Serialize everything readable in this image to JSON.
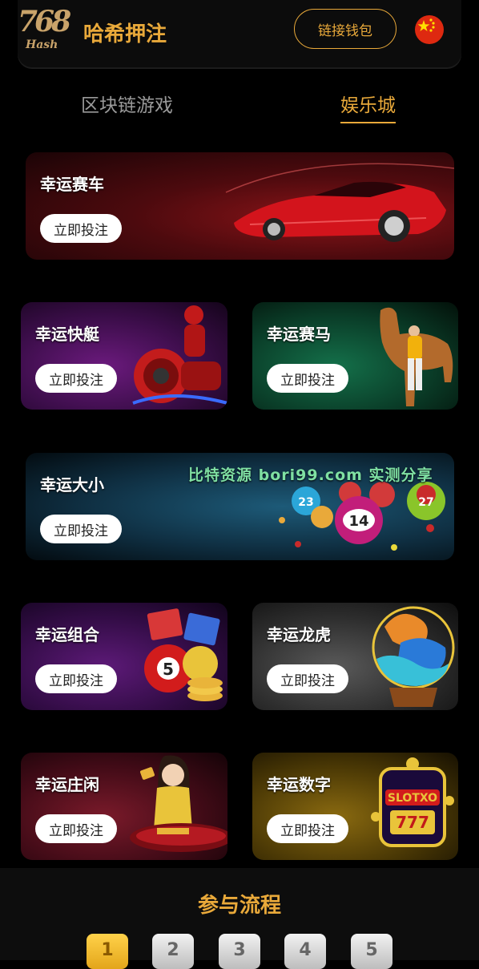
{
  "header": {
    "logo_number": "768",
    "logo_sub": "Hash",
    "brand": "哈希押注",
    "wallet_button": "链接钱包",
    "flag_icon": "china-flag-icon"
  },
  "tabs": [
    {
      "label": "区块链游戏",
      "active": false
    },
    {
      "label": "娱乐城",
      "active": true
    }
  ],
  "bet_label": "立即投注",
  "games": [
    {
      "title": "幸运赛车",
      "art": "red-sports-car"
    },
    {
      "title": "幸运快艇",
      "art": "speedboat-rider"
    },
    {
      "title": "幸运赛马",
      "art": "horse-jockey"
    },
    {
      "title": "幸运大小",
      "art": "lottery-balls"
    },
    {
      "title": "幸运组合",
      "art": "lottery-tickets-coins"
    },
    {
      "title": "幸运龙虎",
      "art": "dragon-tiger"
    },
    {
      "title": "幸运庄闲",
      "art": "casino-dealer"
    },
    {
      "title": "幸运数字",
      "art": "slot-machine"
    }
  ],
  "watermark": "比特资源 bori99.com 实测分享",
  "process": {
    "title": "参与流程",
    "steps": [
      "1",
      "2",
      "3",
      "4",
      "5"
    ],
    "active_step": "1"
  },
  "colors": {
    "accent": "#e9a93a",
    "background": "#000000",
    "inactive_tab": "#9a9a9a"
  }
}
